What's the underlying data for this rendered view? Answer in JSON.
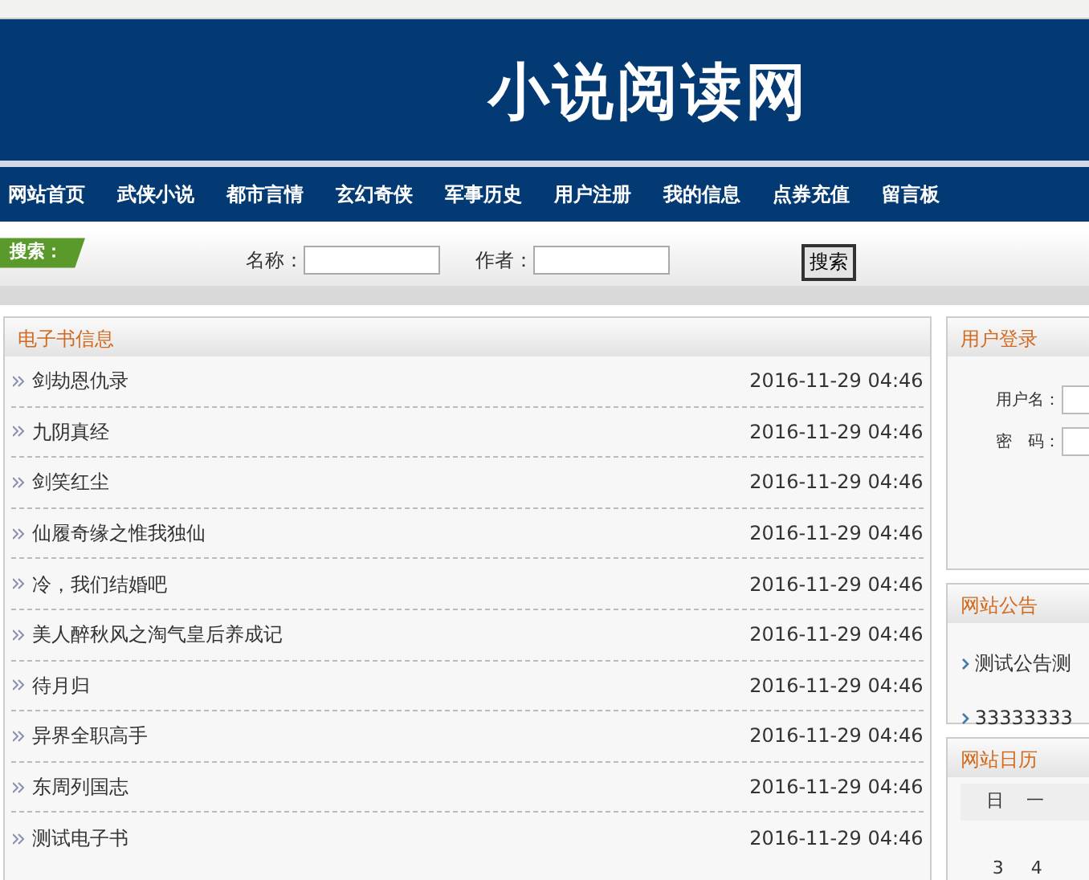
{
  "header": {
    "logo": "小说阅读网"
  },
  "nav": [
    "网站首页",
    "武侠小说",
    "都市言情",
    "玄幻奇侠",
    "军事历史",
    "用户注册",
    "我的信息",
    "点券充值",
    "留言板"
  ],
  "search": {
    "tag": "搜索：",
    "fields": [
      {
        "label": "名称："
      },
      {
        "label": "作者："
      }
    ],
    "button": "搜索"
  },
  "books": {
    "title": "电子书信息",
    "rows": [
      {
        "name": "剑劫恩仇录",
        "date": "2016-11-29 04:46"
      },
      {
        "name": "九阴真经",
        "date": "2016-11-29 04:46"
      },
      {
        "name": "剑笑红尘",
        "date": "2016-11-29 04:46"
      },
      {
        "name": "仙履奇缘之惟我独仙",
        "date": "2016-11-29 04:46"
      },
      {
        "name": "冷，我们结婚吧",
        "date": "2016-11-29 04:46"
      },
      {
        "name": "美人醉秋风之淘气皇后养成记",
        "date": "2016-11-29 04:46"
      },
      {
        "name": "待月归",
        "date": "2016-11-29 04:46"
      },
      {
        "name": "异界全职高手",
        "date": "2016-11-29 04:46"
      },
      {
        "name": "东周列国志",
        "date": "2016-11-29 04:46"
      },
      {
        "name": "测试电子书",
        "date": "2016-11-29 04:46"
      }
    ]
  },
  "login": {
    "title": "用户登录",
    "fields": [
      {
        "label": "用户名："
      },
      {
        "label": "密　码："
      }
    ]
  },
  "notices": {
    "title": "网站公告",
    "items": [
      "测试公告测",
      "33333333"
    ]
  },
  "calendar": {
    "title": "网站日历",
    "weekdays": [
      "日",
      "一"
    ],
    "dates": [
      "3",
      "4"
    ]
  }
}
